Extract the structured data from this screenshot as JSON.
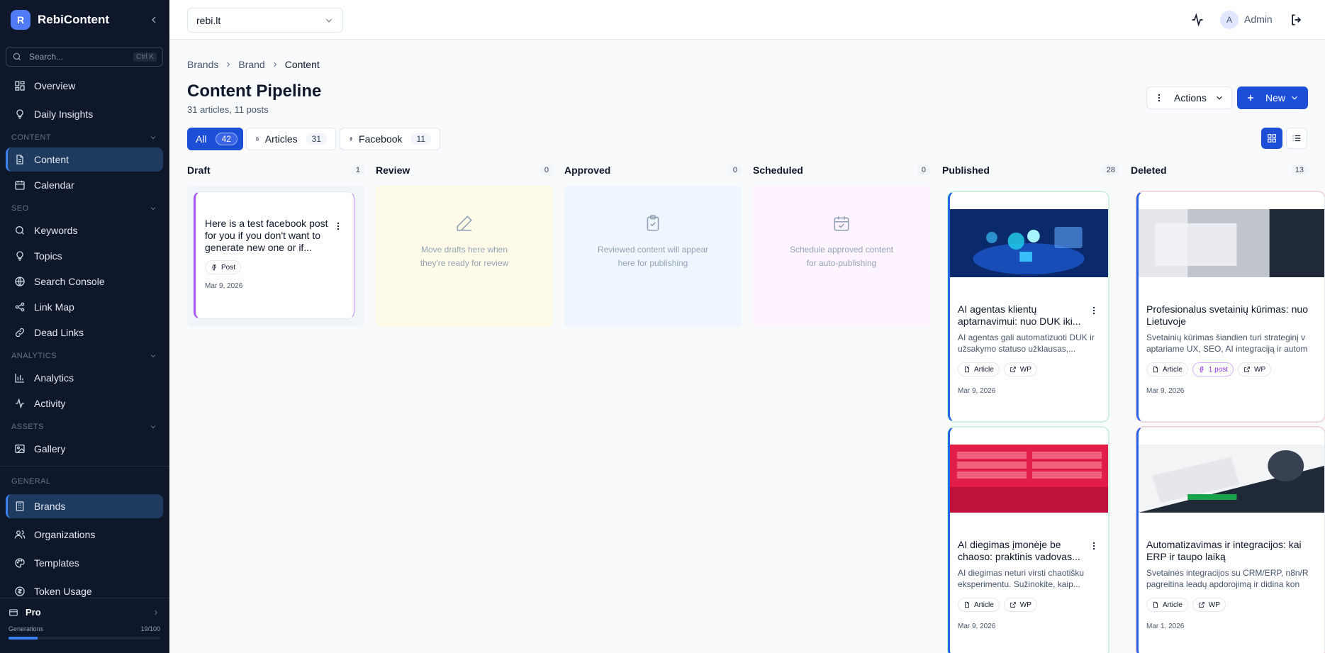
{
  "app": {
    "logo_letter": "R",
    "name": "RebiContent"
  },
  "search": {
    "placeholder": "Search...",
    "shortcut": "Ctrl K"
  },
  "sidebar": {
    "top_items": [
      {
        "label": "Overview",
        "icon": "grid-icon"
      },
      {
        "label": "Daily Insights",
        "icon": "lightbulb-icon"
      }
    ],
    "sections": {
      "content": "CONTENT",
      "seo": "SEO",
      "analytics": "ANALYTICS",
      "assets": "ASSETS",
      "general": "GENERAL"
    },
    "content_items": [
      {
        "label": "Content",
        "icon": "document-icon",
        "active": true
      },
      {
        "label": "Calendar",
        "icon": "calendar-icon"
      }
    ],
    "seo_items": [
      {
        "label": "Keywords",
        "icon": "search-icon"
      },
      {
        "label": "Topics",
        "icon": "bulb-icon"
      },
      {
        "label": "Search Console",
        "icon": "globe-icon"
      },
      {
        "label": "Link Map",
        "icon": "share-icon"
      },
      {
        "label": "Dead Links",
        "icon": "link-icon"
      }
    ],
    "analytics_items": [
      {
        "label": "Analytics",
        "icon": "bar-chart-icon"
      },
      {
        "label": "Activity",
        "icon": "activity-icon"
      }
    ],
    "assets_items": [
      {
        "label": "Gallery",
        "icon": "image-icon"
      }
    ],
    "general_items": [
      {
        "label": "Brands",
        "icon": "building-icon",
        "active": true
      },
      {
        "label": "Organizations",
        "icon": "users-icon"
      },
      {
        "label": "Templates",
        "icon": "palette-icon"
      },
      {
        "label": "Token Usage",
        "icon": "coin-icon"
      }
    ],
    "plan": {
      "name": "Pro",
      "usage_label": "Generations",
      "usage_value": "19/100",
      "usage_fraction": 0.19
    }
  },
  "topbar": {
    "brand_select": "rebi.lt",
    "avatar_letter": "A",
    "user": "Admin"
  },
  "breadcrumb": [
    "Brands",
    "Brand",
    "Content"
  ],
  "page": {
    "title": "Content Pipeline",
    "subtitle": "31 articles, 11 posts",
    "actions_label": "Actions",
    "new_label": "New"
  },
  "filters": [
    {
      "label": "All",
      "count": "42"
    },
    {
      "label": "Articles",
      "count": "31"
    },
    {
      "label": "Facebook",
      "count": "11"
    }
  ],
  "columns": [
    {
      "title": "Draft",
      "count": "1"
    },
    {
      "title": "Review",
      "count": "0",
      "empty": "Move drafts here when they're ready for review"
    },
    {
      "title": "Approved",
      "count": "0",
      "empty": "Reviewed content will appear here for publishing"
    },
    {
      "title": "Scheduled",
      "count": "0",
      "empty": "Schedule approved content for auto-publishing"
    },
    {
      "title": "Published",
      "count": "28"
    },
    {
      "title": "Deleted",
      "count": "13"
    }
  ],
  "draft_card": {
    "text": "Here is a test facebook post for you if you don't want to generate new one or if...",
    "badge": "Post",
    "date": "Mar 9, 2026"
  },
  "published_cards": [
    {
      "title": "AI agentas klientų aptarnavimui: nuo DUK iki...",
      "desc": "AI agentas gali automatizuoti DUK ir užsakymo statuso užklausas,...",
      "badges": [
        "Article",
        "WP"
      ],
      "date": "Mar 9, 2026"
    },
    {
      "title": "AI diegimas įmonėje be chaoso: praktinis vadovas...",
      "desc": "AI diegimas neturi virsti chaotišku eksperimentu. Sužinokite, kaip...",
      "badges": [
        "Article",
        "WP"
      ],
      "date": "Mar 9, 2026"
    }
  ],
  "deleted_cards": [
    {
      "title": "Profesionalus svetainių kūrimas: nuo Lietuvoje",
      "desc": "Svetainių kūrimas šiandien turi strateginį v aptariame UX, SEO, AI integraciją ir autom",
      "badges": [
        "Article",
        "1 post",
        "WP"
      ],
      "date": "Mar 9, 2026"
    },
    {
      "title": "Automatizavimas ir integracijos: kai ERP ir taupo laiką",
      "desc": "Svetainės integracijos su CRM/ERP, n8n/R pagreitina leadų apdorojimą ir didina kon",
      "badges": [
        "Article",
        "WP"
      ],
      "date": "Mar 1, 2026"
    }
  ],
  "colors": {
    "sidebar_bg": "#0f172a",
    "accent": "#1d4ed8",
    "draft_border": "#a855f7",
    "published_border": "#2563eb"
  }
}
